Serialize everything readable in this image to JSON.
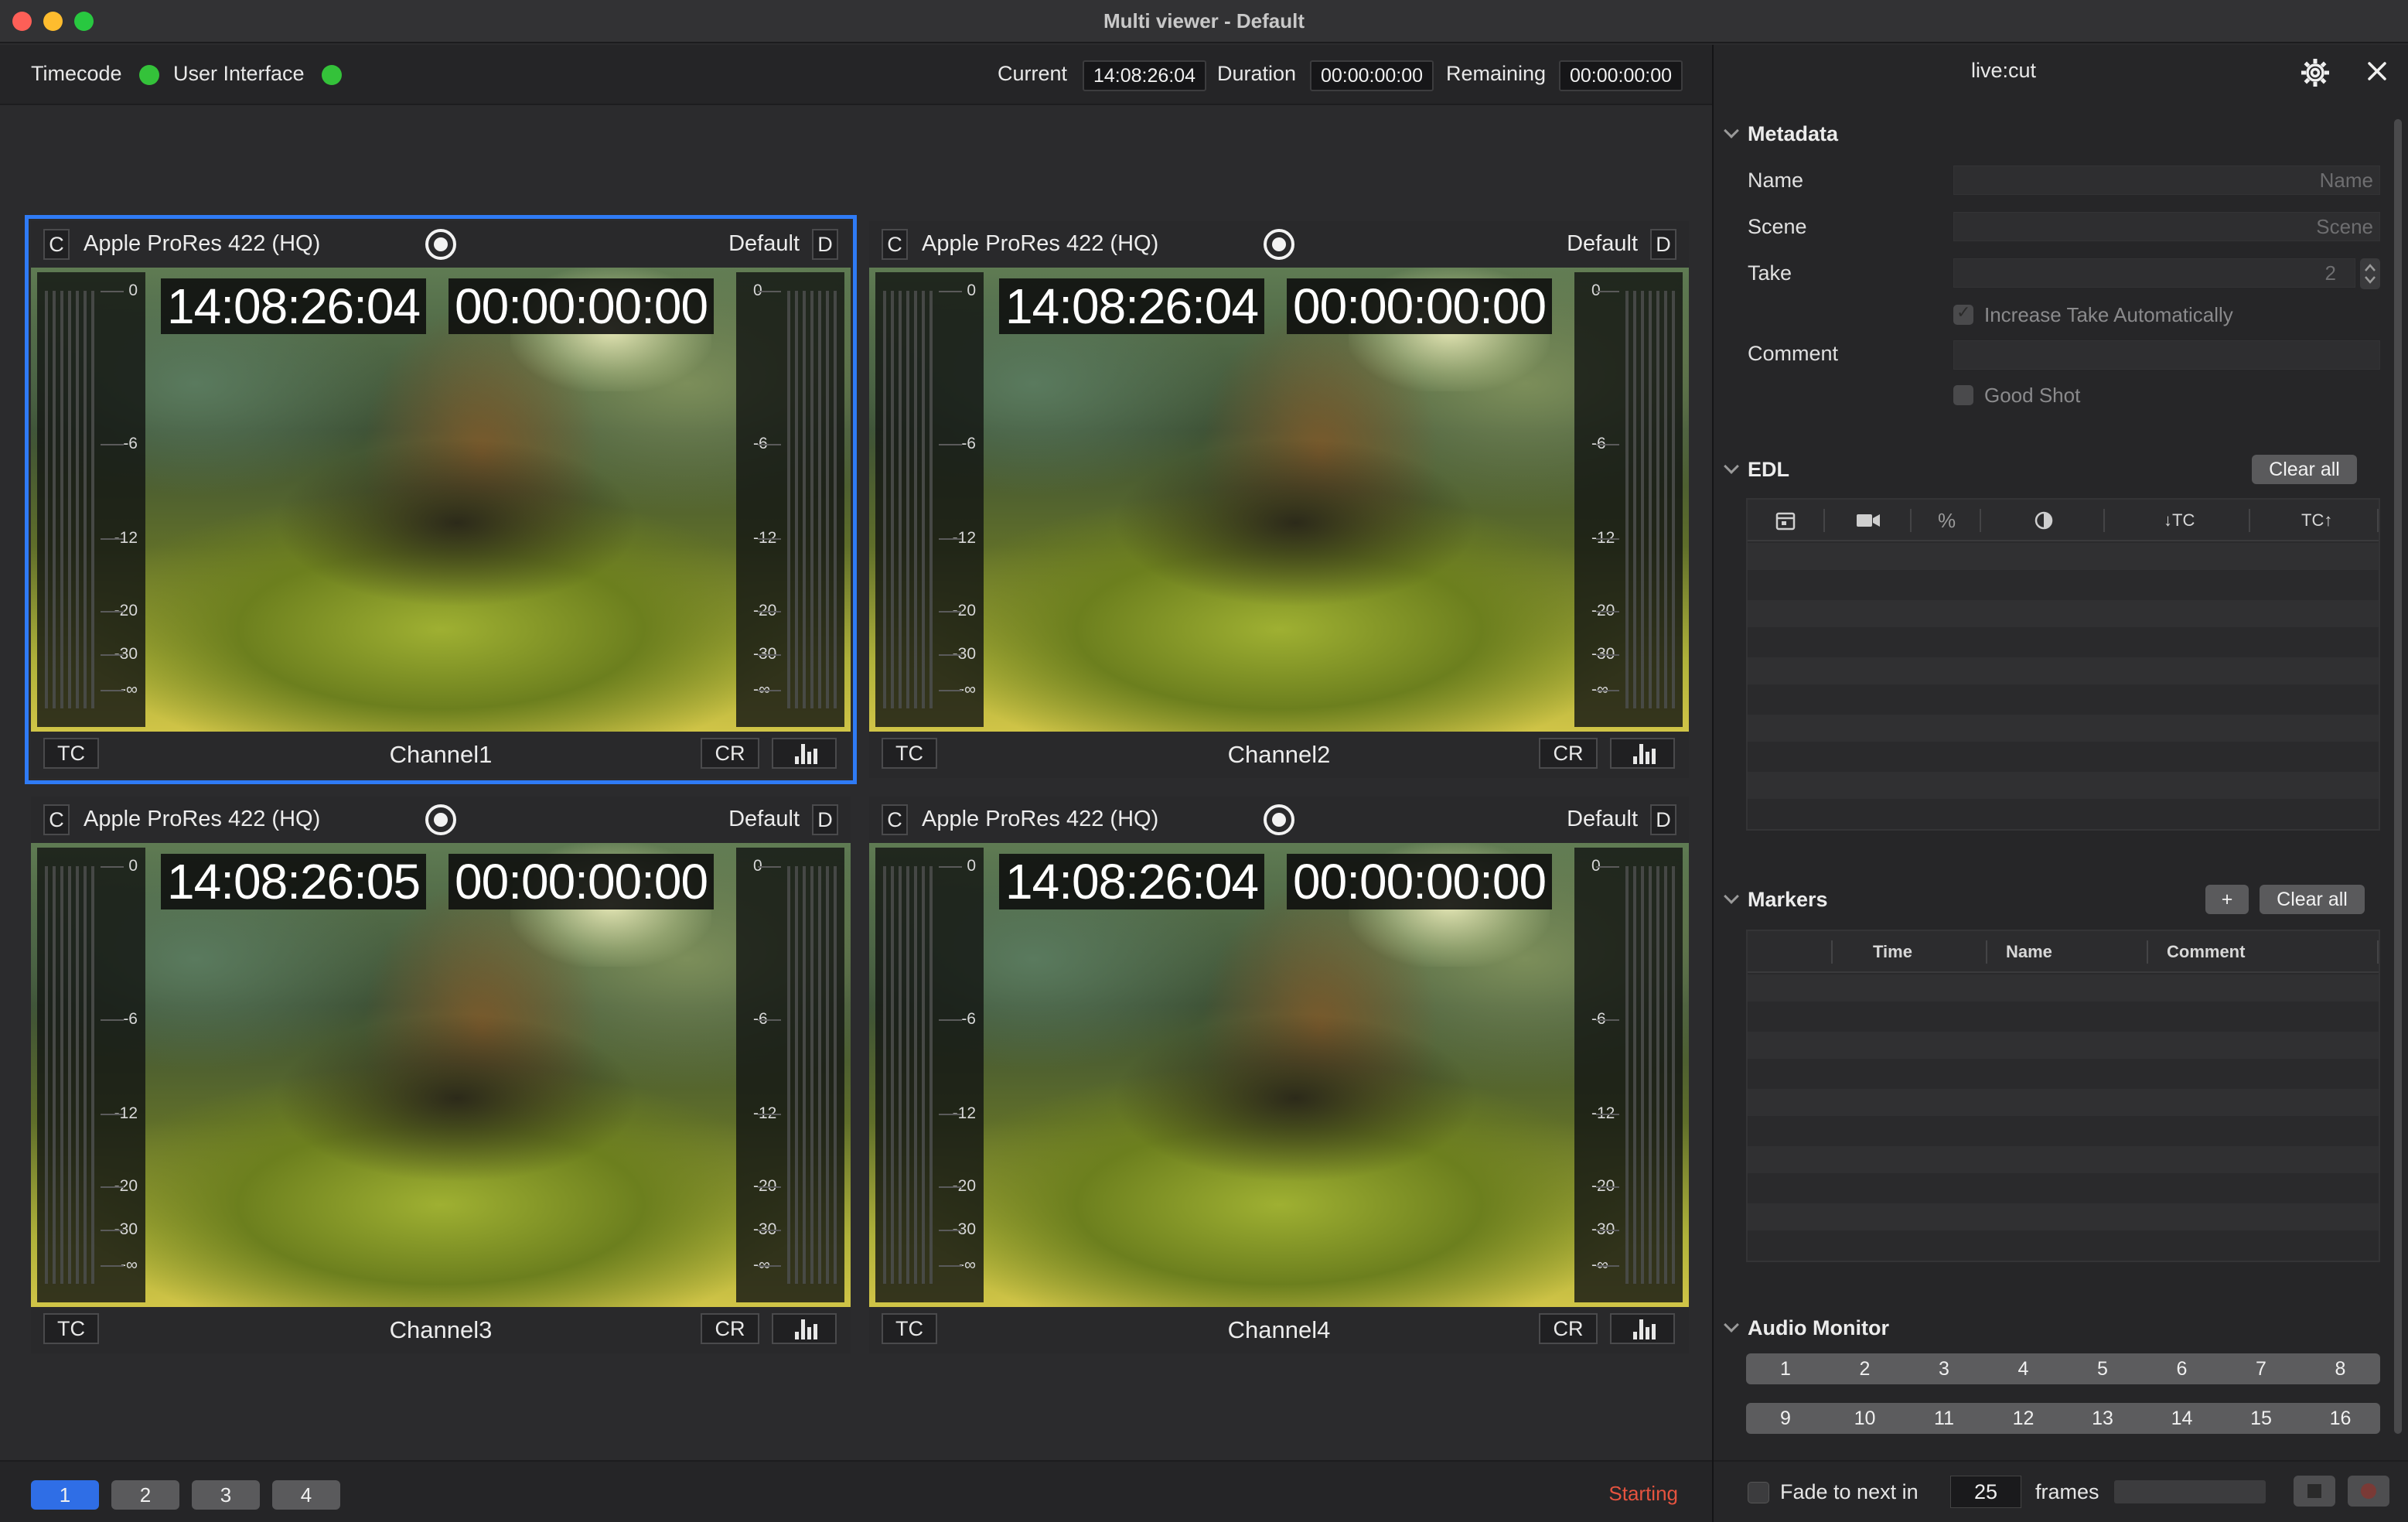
{
  "window": {
    "title": "Multi viewer - Default"
  },
  "status": {
    "timecode_label": "Timecode",
    "ui_label": "User Interface",
    "current_label": "Current",
    "current_value": "14:08:26:04",
    "duration_label": "Duration",
    "duration_value": "00:00:00:00",
    "remaining_label": "Remaining",
    "remaining_value": "00:00:00:00",
    "indicator_color": "#34c23a"
  },
  "channels": [
    {
      "c": "C",
      "codec": "Apple ProRes 422 (HQ)",
      "preset": "Default",
      "d": "D",
      "tc": "14:08:26:04",
      "dur": "00:00:00:00",
      "tc_btn": "TC",
      "name": "Channel1",
      "cr": "CR",
      "selected": true
    },
    {
      "c": "C",
      "codec": "Apple ProRes 422 (HQ)",
      "preset": "Default",
      "d": "D",
      "tc": "14:08:26:04",
      "dur": "00:00:00:00",
      "tc_btn": "TC",
      "name": "Channel2",
      "cr": "CR",
      "selected": false
    },
    {
      "c": "C",
      "codec": "Apple ProRes 422 (HQ)",
      "preset": "Default",
      "d": "D",
      "tc": "14:08:26:05",
      "dur": "00:00:00:00",
      "tc_btn": "TC",
      "name": "Channel3",
      "cr": "CR",
      "selected": false
    },
    {
      "c": "C",
      "codec": "Apple ProRes 422 (HQ)",
      "preset": "Default",
      "d": "D",
      "tc": "14:08:26:04",
      "dur": "00:00:00:00",
      "tc_btn": "TC",
      "name": "Channel4",
      "cr": "CR",
      "selected": false
    }
  ],
  "meter_scale": [
    "0",
    "-6",
    "-12",
    "-20",
    "-30",
    "-∞"
  ],
  "pages": {
    "buttons": [
      "1",
      "2",
      "3",
      "4"
    ],
    "active": 0,
    "state": "Starting"
  },
  "panel": {
    "title": "live:cut",
    "metadata": {
      "header": "Metadata",
      "name_label": "Name",
      "name_placeholder": "Name",
      "scene_label": "Scene",
      "scene_placeholder": "Scene",
      "take_label": "Take",
      "take_value": "2",
      "increase_take": "Increase Take Automatically",
      "comment_label": "Comment",
      "good_shot": "Good Shot"
    },
    "edl": {
      "header": "EDL",
      "clear": "Clear all",
      "col_tc_in": "↓TC",
      "col_tc_out": "TC↑",
      "col_percent": "%"
    },
    "markers": {
      "header": "Markers",
      "add": "+",
      "clear": "Clear all",
      "cols": [
        "Time",
        "Name",
        "Comment"
      ]
    },
    "audio_monitor": {
      "header": "Audio Monitor",
      "row1": [
        "1",
        "2",
        "3",
        "4",
        "5",
        "6",
        "7",
        "8"
      ],
      "row2": [
        "9",
        "10",
        "11",
        "12",
        "13",
        "14",
        "15",
        "16"
      ]
    },
    "bottom": {
      "fade_label": "Fade to next in",
      "fade_value": "25",
      "frames_label": "frames"
    }
  }
}
